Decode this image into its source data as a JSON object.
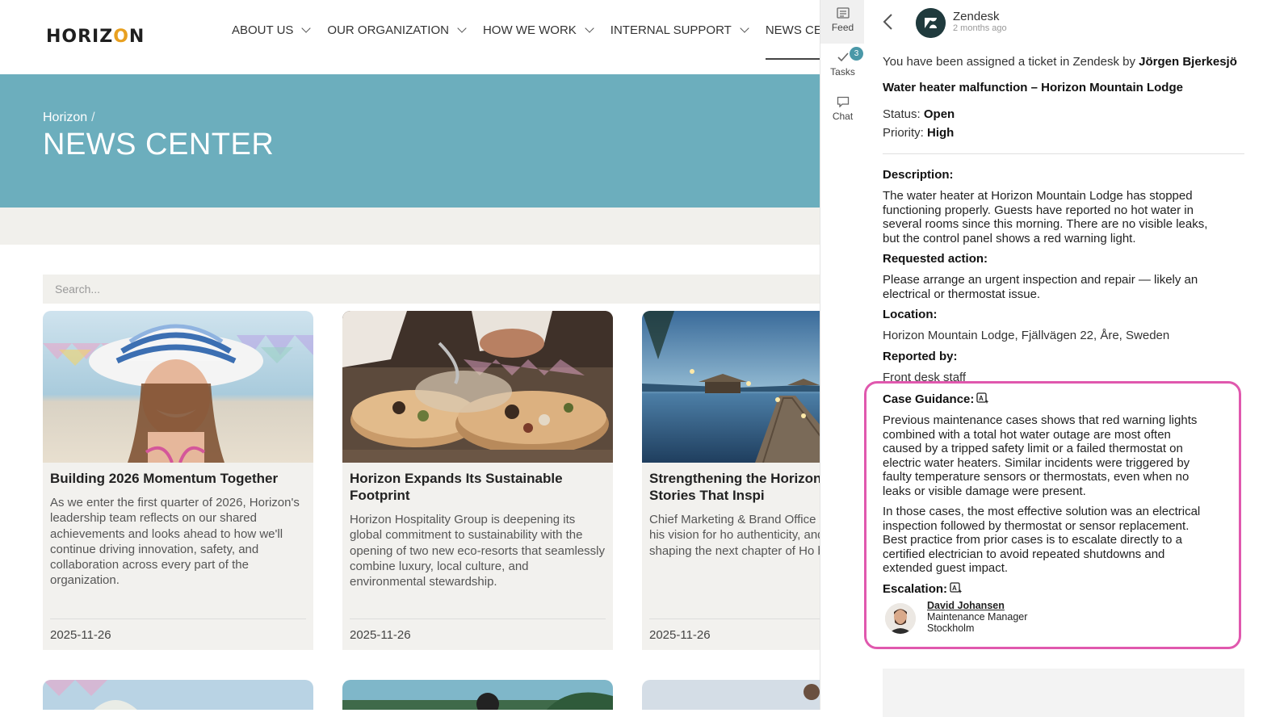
{
  "site": {
    "logo": "HORIZON",
    "nav": [
      {
        "label": "ABOUT US"
      },
      {
        "label": "OUR ORGANIZATION"
      },
      {
        "label": "HOW WE WORK"
      },
      {
        "label": "INTERNAL SUPPORT"
      },
      {
        "label": "NEWS CENT"
      }
    ],
    "breadcrumb": {
      "root": "Horizon",
      "separator": "/"
    },
    "page_title": "NEWS CENTER",
    "search": {
      "placeholder": "Search..."
    },
    "cards": [
      {
        "title": "Building 2026 Momentum Together",
        "excerpt": "As we enter the first quarter of 2026, Horizon's leadership team reflects on our shared achievements and looks ahead to how we'll continue driving innovation, safety, and collaboration across every part of the organization.",
        "date": "2025-11-26"
      },
      {
        "title": "Horizon Expands Its Sustainable Footprint",
        "excerpt": "Horizon Hospitality Group is deepening its global commitment to sustainability with the opening of two new eco-resorts that seamlessly combine luxury, local culture, and environmental stewardship.",
        "date": "2025-11-26"
      },
      {
        "title": "Strengthening the Horizon Through Stories That Inspi",
        "excerpt": "Chief Marketing & Brand Office Leclerc shares his vision for ho authenticity, and digital engag shaping the next chapter of Ho brand.",
        "date": "2025-11-26"
      }
    ]
  },
  "rail": {
    "feed": "Feed",
    "tasks": "Tasks",
    "tasks_badge": "3",
    "chat": "Chat"
  },
  "ticket": {
    "source": "Zendesk",
    "time": "2 months ago",
    "assigned_prefix": "You have been assigned a ticket in Zendesk by ",
    "assigned_by": "Jörgen Bjerkesjö",
    "title": "Water heater malfunction – Horizon Mountain Lodge",
    "status_label": "Status: ",
    "status": "Open",
    "priority_label": "Priority: ",
    "priority": "High",
    "description_label": "Description:",
    "description": "The water heater at Horizon Mountain Lodge has stopped functioning properly. Guests have reported no hot water in several rooms since this morning. There are no visible leaks, but the control panel shows a red warning light.",
    "requested_label": "Requested action:",
    "requested": "Please arrange an urgent inspection and repair — likely an electrical or thermostat issue.",
    "location_label": "Location:",
    "location": "Horizon Mountain Lodge, Fjällvägen 22, Åre, Sweden",
    "reported_label": "Reported by:",
    "reported": "Front desk staff"
  },
  "guidance": {
    "label": "Case Guidance:",
    "para1": "Previous maintenance cases shows that red warning lights combined with a total hot water outage are most often caused by a tripped safety limit or a failed thermostat on electric water heaters. Similar incidents were triggered by faulty temperature sensors or thermostats, even when no leaks or visible damage were present.",
    "para2": "In those cases, the most effective solution was an electrical inspection followed by thermostat or sensor replacement. Best practice from prior cases is to escalate directly to a certified electrician to avoid repeated shutdowns and extended guest impact.",
    "escalation_label": "Escalation:",
    "contact": {
      "name": "David Johansen",
      "role": "Maintenance Manager",
      "city": "Stockholm"
    },
    "accent": "#e058ae"
  },
  "colors": {
    "hero": "#6caebd",
    "badge": "#4a98a8",
    "logo_accent": "#e8a020"
  }
}
